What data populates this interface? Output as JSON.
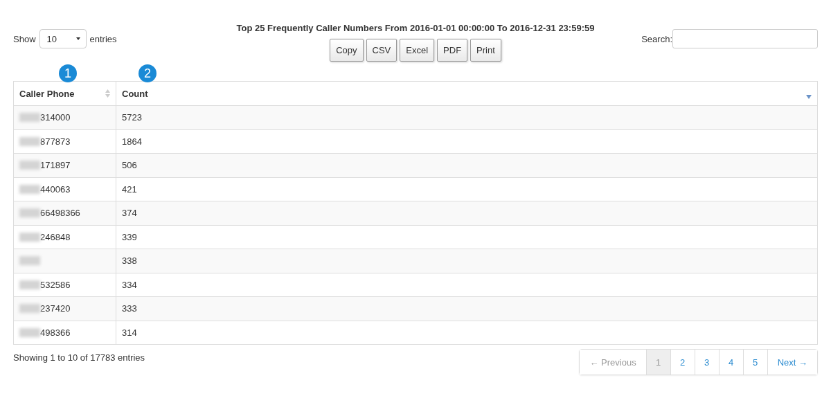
{
  "report": {
    "title": "Top 25 Frequently Caller Numbers From 2016-01-01 00:00:00 To 2016-12-31 23:59:59"
  },
  "length_menu": {
    "before": "Show",
    "value": "10",
    "after": "entries"
  },
  "export_buttons": [
    "Copy",
    "CSV",
    "Excel",
    "PDF",
    "Print"
  ],
  "search": {
    "label": "Search:"
  },
  "callouts": [
    "1",
    "2"
  ],
  "table": {
    "columns": [
      {
        "label": "Caller Phone",
        "sorted": false
      },
      {
        "label": "Count",
        "sorted": true
      }
    ],
    "rows": [
      {
        "redacted": true,
        "phone": "314000",
        "count": "5723"
      },
      {
        "redacted": true,
        "phone": "877873",
        "count": "1864"
      },
      {
        "redacted": true,
        "phone": "171897",
        "count": "506"
      },
      {
        "redacted": true,
        "phone": "440063",
        "count": "421"
      },
      {
        "redacted": true,
        "phone": "66498366",
        "count": "374"
      },
      {
        "redacted": true,
        "phone": "246848",
        "count": "339"
      },
      {
        "redacted": true,
        "count": "338"
      },
      {
        "redacted": true,
        "phone": "532586",
        "count": "334"
      },
      {
        "redacted": true,
        "phone": "237420",
        "count": "333"
      },
      {
        "redacted": true,
        "phone": "498366",
        "count": "314"
      }
    ]
  },
  "info": "Showing 1 to 10 of 17783 entries",
  "pagination": [
    {
      "label": "← Previous",
      "kind": "nav",
      "disabled": true,
      "selected": false
    },
    {
      "label": "1",
      "kind": "page",
      "disabled": false,
      "selected": true
    },
    {
      "label": "2",
      "kind": "page",
      "disabled": false,
      "selected": false
    },
    {
      "label": "3",
      "kind": "page",
      "disabled": false,
      "selected": false
    },
    {
      "label": "4",
      "kind": "page",
      "disabled": false,
      "selected": false
    },
    {
      "label": "5",
      "kind": "page",
      "disabled": false,
      "selected": false
    },
    {
      "label": "Next →",
      "kind": "nav",
      "disabled": false,
      "selected": false
    }
  ]
}
